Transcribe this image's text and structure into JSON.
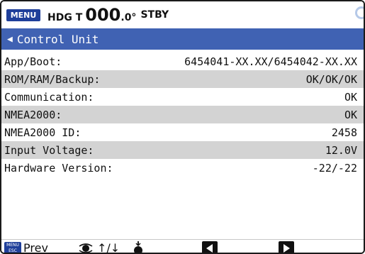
{
  "topbar": {
    "menu_label": "MENU",
    "hdg_label": "HDG T",
    "hdg_value": "000",
    "hdg_decimal": ".0°",
    "mode": "STBY"
  },
  "header": {
    "back_icon": "left-triangle-icon",
    "title": "Control Unit"
  },
  "rows": [
    {
      "label": "App/Boot:",
      "value": "6454041-XX.XX/6454042-XX.XX"
    },
    {
      "label": "ROM/RAM/Backup:",
      "value": "OK/OK/OK"
    },
    {
      "label": "Communication:",
      "value": "OK"
    },
    {
      "label": "NMEA2000:",
      "value": "OK"
    },
    {
      "label": "NMEA2000 ID:",
      "value": "2458"
    },
    {
      "label": "Input Voltage:",
      "value": "12.0V"
    },
    {
      "label": "Hardware Version:",
      "value": "-22/-22"
    }
  ],
  "bottombar": {
    "menu_esc_icon": "menu-esc-key-icon",
    "menu_esc_text": "MENU ESC",
    "prev_label": "Prev",
    "knob_arrows_label": "↑/↓",
    "left_key_icon": "left-arrow-key-icon",
    "right_key_icon": "right-arrow-key-icon"
  },
  "colors": {
    "accent": "#4062b3",
    "menu_button": "#1f3f9a",
    "row_shade": "#d3d3d3"
  }
}
